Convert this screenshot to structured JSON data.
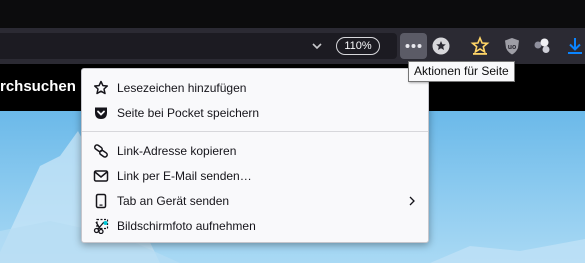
{
  "toolbar": {
    "zoom_level": "110%",
    "page_actions_tooltip": "Aktionen für Seite"
  },
  "page": {
    "heading_fragment": "rchsuchen"
  },
  "menu": {
    "items": [
      {
        "label": "Lesezeichen hinzufügen",
        "icon": "star-icon"
      },
      {
        "label": "Seite bei Pocket speichern",
        "icon": "pocket-icon"
      },
      {
        "label": "Link-Adresse kopieren",
        "icon": "link-icon"
      },
      {
        "label": "Link per E-Mail senden…",
        "icon": "email-icon"
      },
      {
        "label": "Tab an Gerät senden",
        "icon": "device-icon",
        "has_submenu": true
      },
      {
        "label": "Bildschirmfoto aufnehmen",
        "icon": "screenshot-icon"
      }
    ]
  },
  "colors": {
    "toolbar_bg": "#2b2a33",
    "menu_bg": "#f9f9fb",
    "download_accent": "#0a84ff",
    "bookmark_accent": "#ffd567"
  }
}
